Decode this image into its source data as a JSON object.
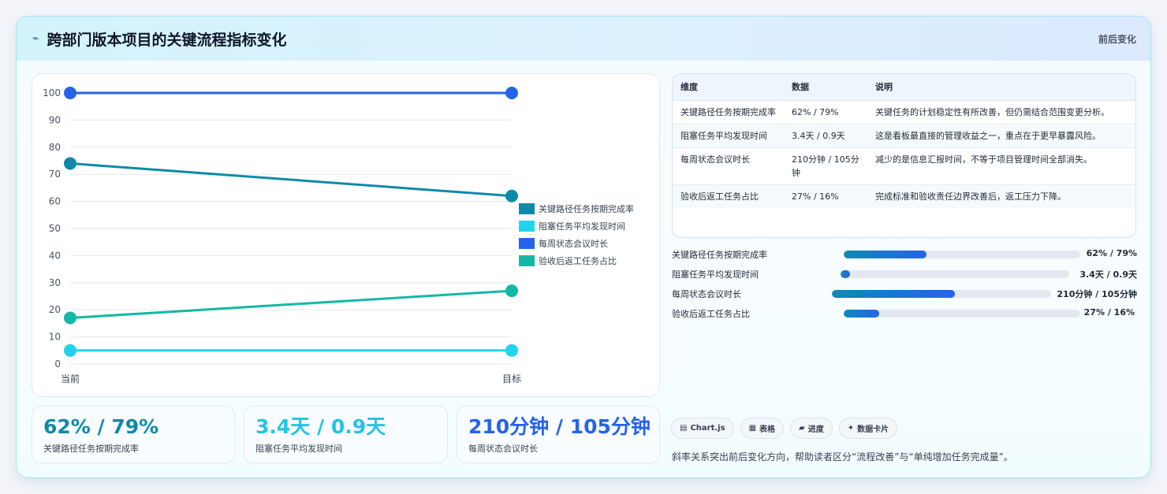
{
  "header": {
    "icon": "trend-icon",
    "title": "跨部门版本项目的关键流程指标变化",
    "tag": "前后变化"
  },
  "chart_data": {
    "type": "line",
    "title": "",
    "x": [
      "当前",
      "目标"
    ],
    "ylim": [
      0,
      100
    ],
    "yticks": [
      0,
      10,
      20,
      30,
      40,
      50,
      60,
      70,
      80,
      90,
      100
    ],
    "grid": true,
    "legend_position": "right",
    "series": [
      {
        "name": "关键路径任务按期完成率",
        "values": [
          74,
          62
        ],
        "color": "#0e8aa8"
      },
      {
        "name": "阻塞任务平均发现时间",
        "values": [
          5,
          5
        ],
        "color": "#22d3ee"
      },
      {
        "name": "每周状态会议时长",
        "values": [
          100,
          100
        ],
        "color": "#2563eb"
      },
      {
        "name": "验收后返工任务占比",
        "values": [
          17,
          27
        ],
        "color": "#14b8a6"
      }
    ]
  },
  "kpis": [
    {
      "value": "62% / 79%",
      "label": "关键路径任务按期完成率",
      "color": "#0e8aa8"
    },
    {
      "value": "3.4天 / 0.9天",
      "label": "阻塞任务平均发现时间",
      "color": "#22c3e6"
    },
    {
      "value": "210分钟 / 105分钟",
      "label": "每周状态会议时长",
      "color": "#2563eb"
    }
  ],
  "table": {
    "headers": [
      "维度",
      "数据",
      "说明"
    ],
    "rows": [
      {
        "dim": "关键路径任务按期完成率",
        "data": "62% / 79%",
        "note": "关键任务的计划稳定性有所改善，但仍需结合范围变更分析。"
      },
      {
        "dim": "阻塞任务平均发现时间",
        "data": "3.4天 / 0.9天",
        "note": "这是看板最直接的管理收益之一，重点在于更早暴露风险。"
      },
      {
        "dim": "每周状态会议时长",
        "data": "210分钟 / 105分钟",
        "note": "减少的是信息汇报时间，不等于项目管理时间全部消失。"
      },
      {
        "dim": "验收后返工任务占比",
        "data": "27% / 16%",
        "note": "完成标准和验收责任边界改善后，返工压力下降。"
      }
    ]
  },
  "progress": [
    {
      "label": "关键路径任务按期完成率",
      "value": "62% / 79%",
      "fill": 0.35
    },
    {
      "label": "阻塞任务平均发现时间",
      "value": "3.4天 / 0.9天",
      "fill": 0.04
    },
    {
      "label": "每周状态会议时长",
      "value": "210分钟 / 105分钟",
      "fill": 0.56
    },
    {
      "label": "验收后返工任务占比",
      "value": "27% / 16%",
      "fill": 0.15
    }
  ],
  "chips": [
    {
      "icon": "chart-icon",
      "label": "Chart.js"
    },
    {
      "icon": "table-icon",
      "label": "表格"
    },
    {
      "icon": "progress-icon",
      "label": "进度"
    },
    {
      "icon": "sparkle-icon",
      "label": "数据卡片"
    }
  ],
  "footnote": "斜率关系突出前后变化方向，帮助读者区分“流程改善”与“单纯增加任务完成量”。"
}
